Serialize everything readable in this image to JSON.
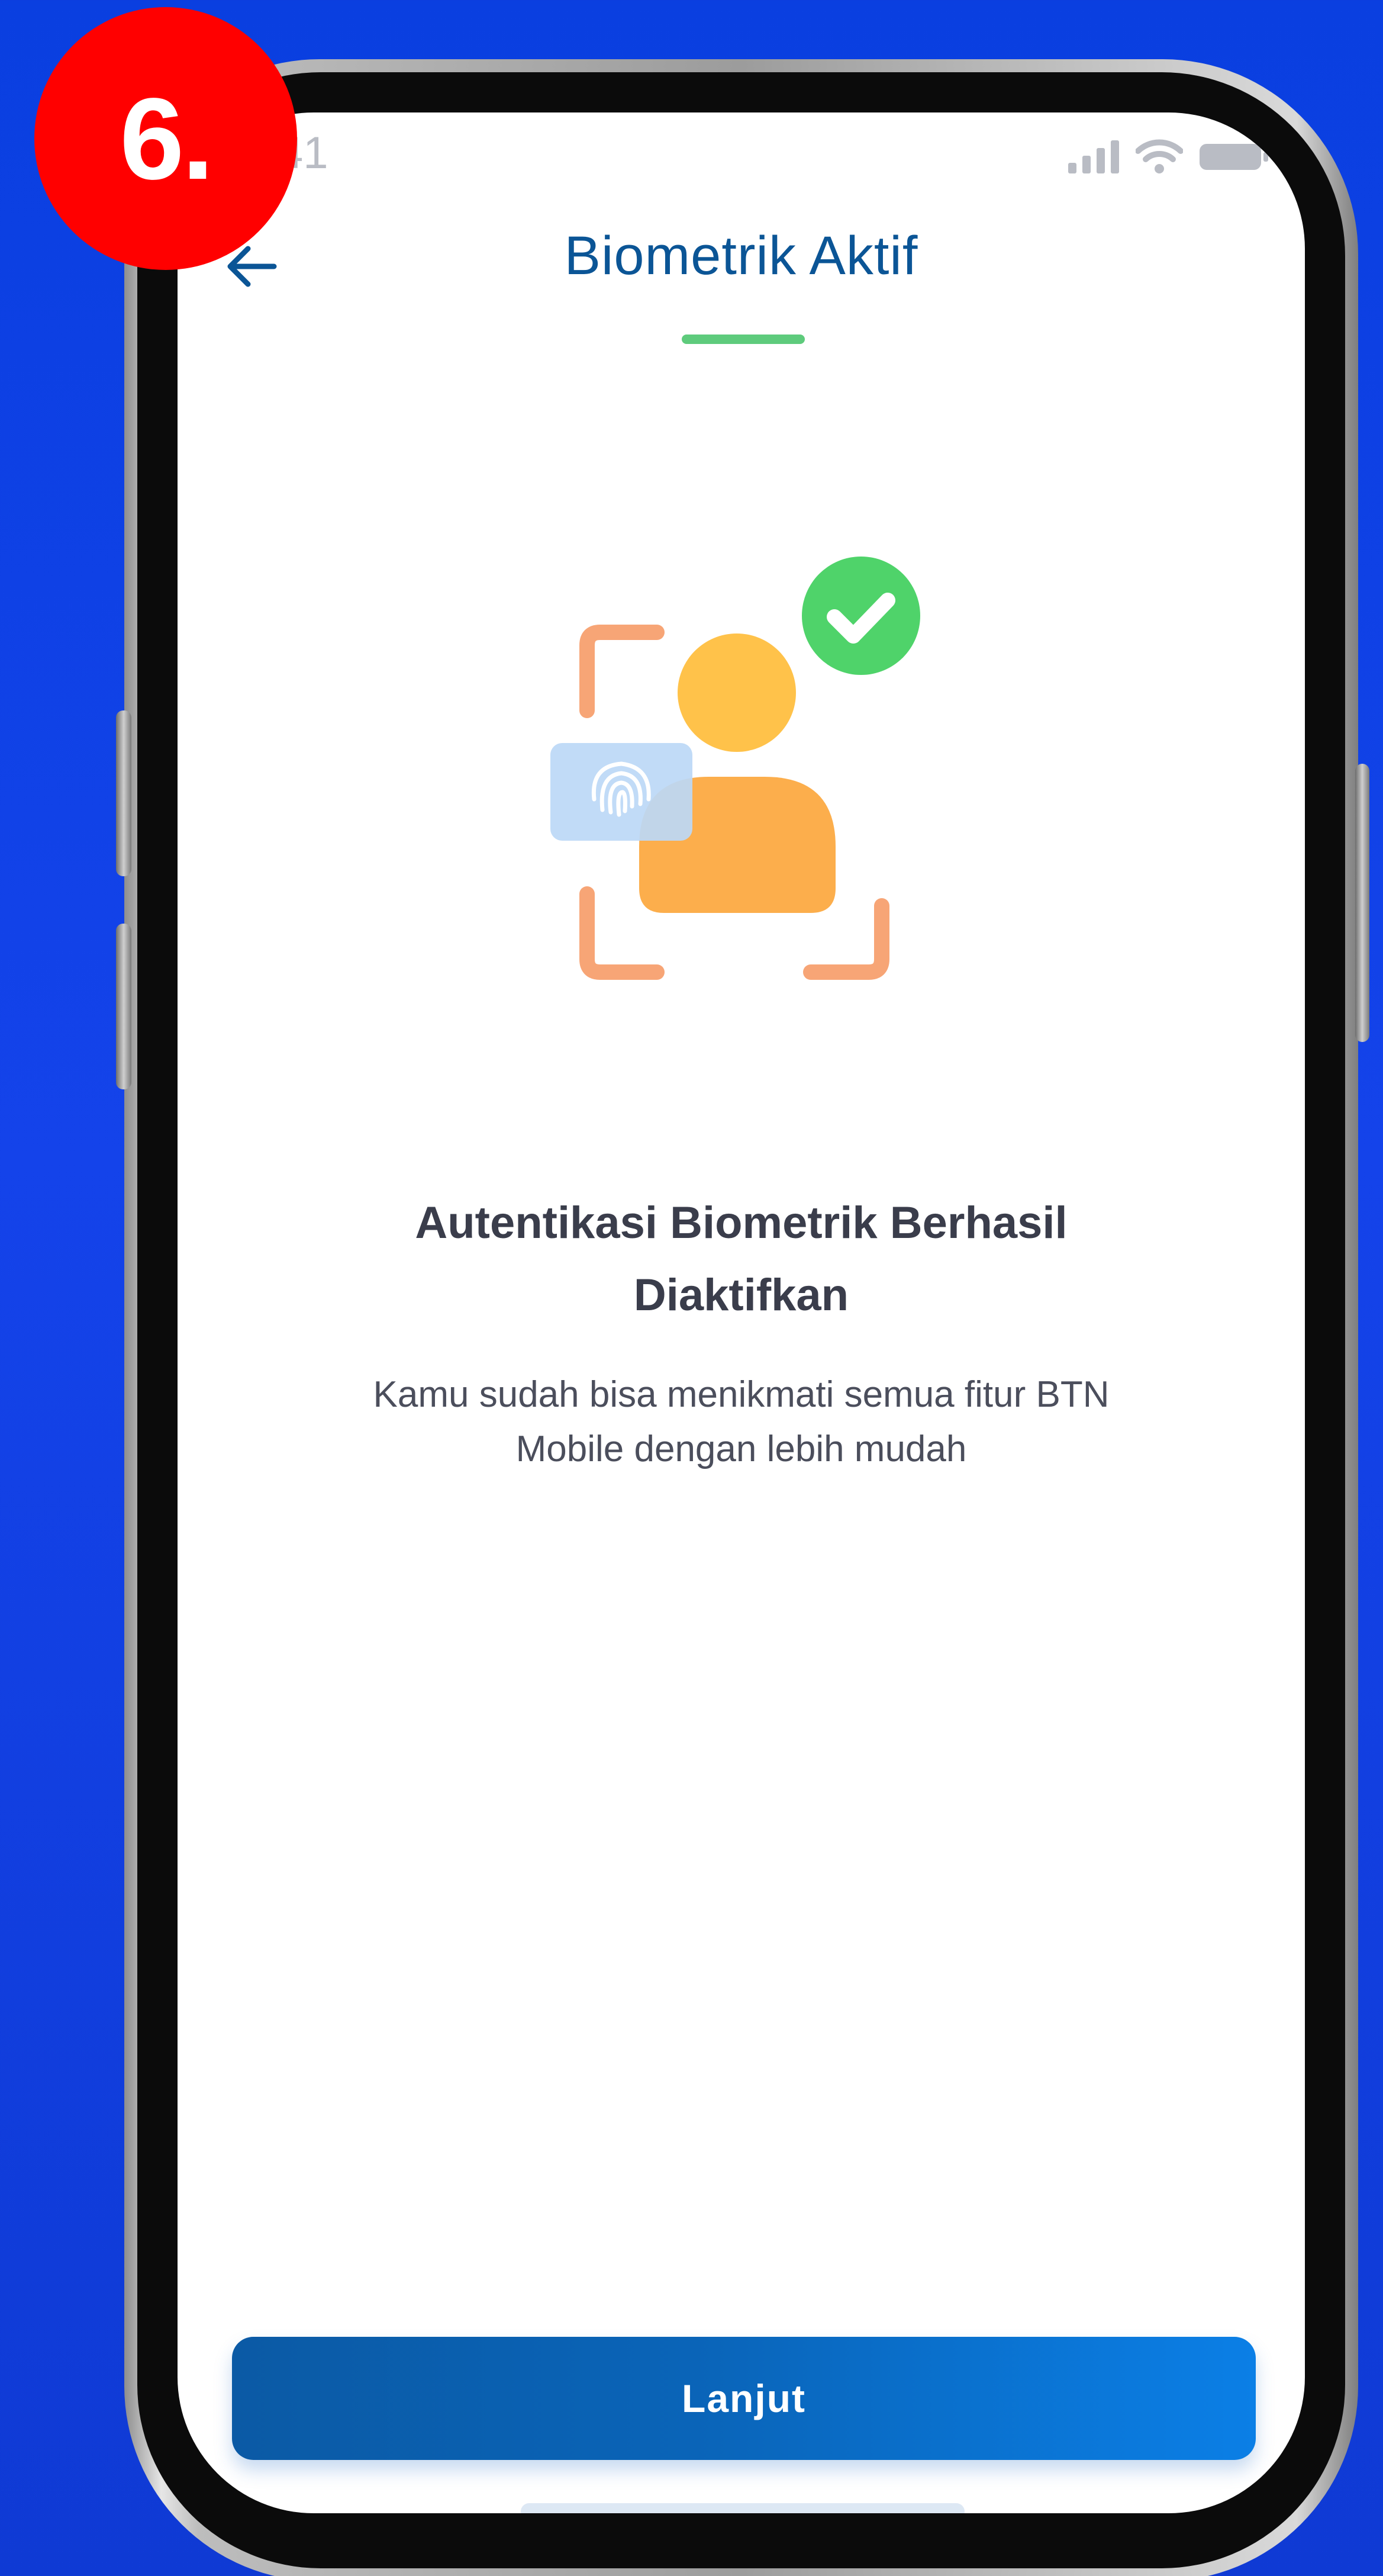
{
  "step_badge": {
    "label": "6."
  },
  "status_bar": {
    "time": "41",
    "icons": [
      "signal-icon",
      "wifi-icon",
      "battery-icon"
    ]
  },
  "header": {
    "back_icon": "arrow-left-icon",
    "title": "Biometrik Aktif",
    "accent_color": "#5ecb7c"
  },
  "illustration": {
    "icons": [
      "face-scan-frame-icon",
      "user-icon",
      "fingerprint-card-icon",
      "checkmark-badge-icon"
    ],
    "colors": {
      "frame": "#f7a576",
      "user": "#ffc24a",
      "card": "#bcd8f6",
      "check": "#4fd36a"
    }
  },
  "message": {
    "title_line1": "Autentikasi Biometrik Berhasil",
    "title_line2": "Diaktifkan",
    "desc_line1": "Kamu sudah bisa menikmati semua fitur BTN",
    "desc_line2": "Mobile dengan lebih mudah"
  },
  "actions": {
    "continue_label": "Lanjut",
    "button_color": "#0b64b8"
  },
  "colors": {
    "background": "#1443ea",
    "title": "#0b5596"
  }
}
